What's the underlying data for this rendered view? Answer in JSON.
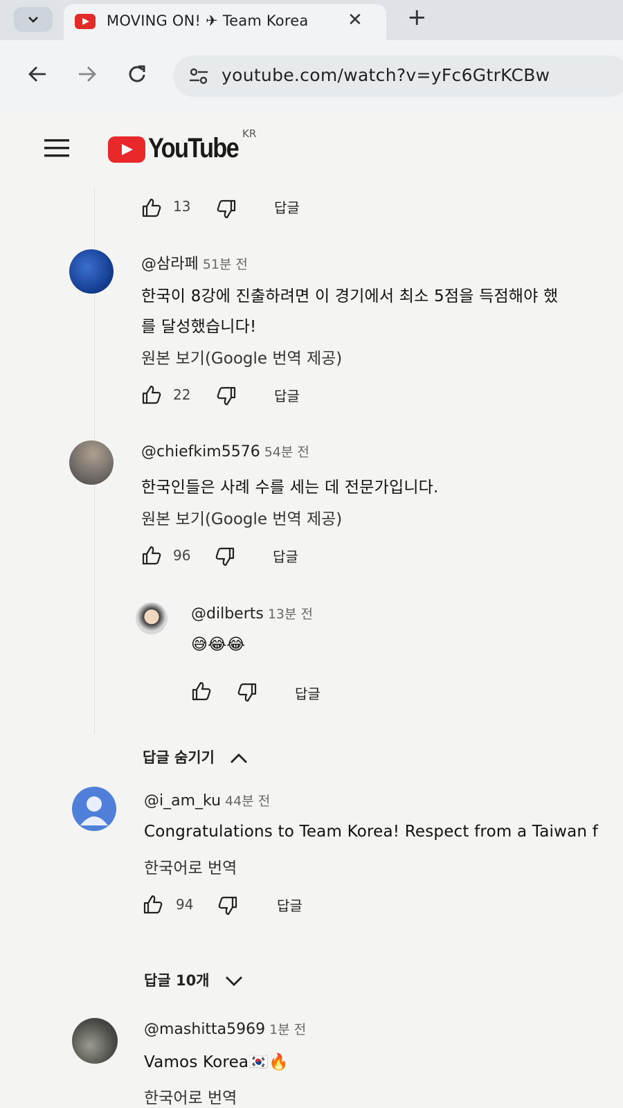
{
  "browser": {
    "tab_title": "MOVING ON! ✈ Team Korea",
    "url": "youtube.com/watch?v=yFc6GtrKCBw"
  },
  "masthead": {
    "logo_text": "YouTube",
    "country_code": "KR"
  },
  "comments": [
    {
      "likes": "13",
      "reply": "답글"
    },
    {
      "author": "@삼라페",
      "time": "51분 전",
      "text_line1": "한국이 8강에 진출하려면 이 경기에서 최소 5점을 득점해야 했",
      "text_line2": "를 달성했습니다!",
      "view_original": "원본 보기(Google 번역 제공)",
      "likes": "22",
      "reply": "답글"
    },
    {
      "author": "@chiefkim5576",
      "time": "54분 전",
      "text_line1": "한국인들은 사례 수를 세는 데 전문가입니다.",
      "view_original": "원본 보기(Google 번역 제공)",
      "likes": "96",
      "reply": "답글"
    },
    {
      "author": "@dilberts",
      "time": "13분 전",
      "text_line1": "😅😂😂",
      "reply": "답글"
    },
    {
      "author": "@i_am_ku",
      "time": "44분 전",
      "text_line1": "Congratulations to Team Korea! Respect from a Taiwan f",
      "translate": "한국어로 번역",
      "likes": "94",
      "reply": "답글"
    },
    {
      "author": "@mashitta5969",
      "time": "1분 전",
      "text_line1": "Vamos Korea🇰🇷🔥",
      "translate": "한국어로 번역"
    }
  ],
  "toggles": {
    "hide_replies": "답글 숨기기",
    "show_replies": "답글 10개"
  },
  "icons": [
    "chevron-down-icon",
    "youtube-favicon",
    "close-icon",
    "plus-icon",
    "back-icon",
    "forward-icon",
    "reload-icon",
    "site-settings-icon",
    "hamburger-icon",
    "like-icon",
    "dislike-icon",
    "chevron-up-icon"
  ]
}
